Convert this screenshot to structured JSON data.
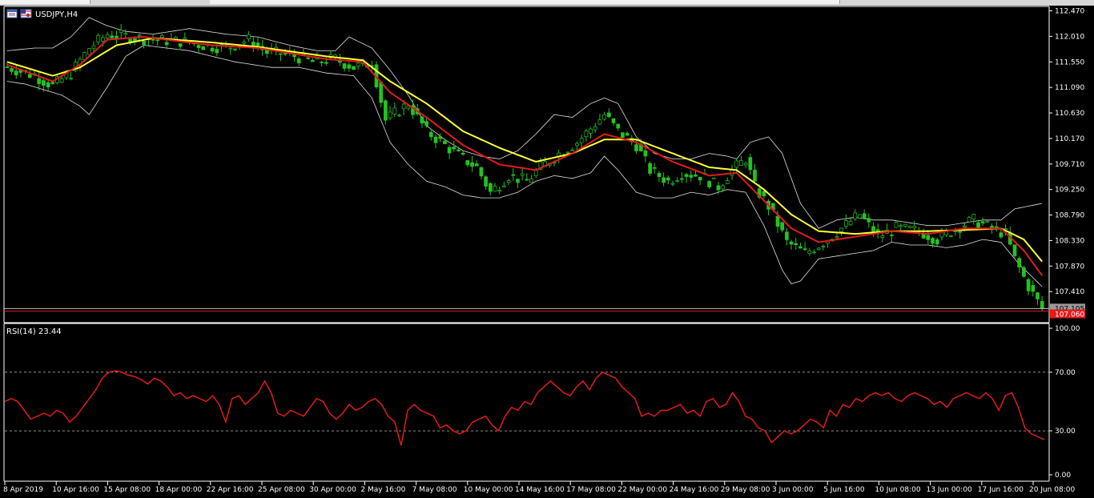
{
  "window": {
    "symbol_title": "USDJPY,H4",
    "icon": "chart-window-icon"
  },
  "colors": {
    "background": "#000000",
    "grid": "#1a1a1a",
    "axis": "#ffffff",
    "bull_candle": "#22c322",
    "bear_candle": "#c8f0c8",
    "ma_fast": "#e31b1b",
    "ma_slow": "#ffff33",
    "bollinger": "#e0e0e0",
    "rsi": "#e31b1b",
    "rsi_levels": "#c0c0c0",
    "bid_line": "#c0c0c0",
    "ask_line": "#e31b1b"
  },
  "chart_data": [
    {
      "type": "candlestick",
      "title": "USDJPY,H4",
      "ylim": [
        106.85,
        112.55
      ],
      "price_ticks": [
        "112.470",
        "112.010",
        "111.550",
        "111.090",
        "110.630",
        "110.170",
        "109.710",
        "109.250",
        "108.790",
        "108.330",
        "107.870",
        "107.410"
      ],
      "current_bid": "107.105",
      "current_ask": "107.060",
      "x_ticks": [
        "8 Apr 2019",
        "10 Apr 16:00",
        "15 Apr 08:00",
        "18 Apr 00:00",
        "22 Apr 16:00",
        "25 Apr 08:00",
        "30 Apr 00:00",
        "2 May 16:00",
        "7 May 08:00",
        "10 May 00:00",
        "14 May 16:00",
        "17 May 08:00",
        "22 May 00:00",
        "24 May 16:00",
        "29 May 08:00",
        "3 Jun 00:00",
        "5 Jun 16:00",
        "10 Jun 08:00",
        "13 Jun 00:00",
        "17 Jun 16:00",
        "20 Jun 08:00"
      ],
      "close_path": [
        [
          0,
          111.46
        ],
        [
          6,
          111.3
        ],
        [
          10,
          111.12
        ],
        [
          14,
          111.35
        ],
        [
          18,
          111.8
        ],
        [
          22,
          112.05
        ],
        [
          27,
          112.0
        ],
        [
          32,
          111.95
        ],
        [
          38,
          111.92
        ],
        [
          43,
          111.85
        ],
        [
          48,
          111.8
        ],
        [
          53,
          111.95
        ],
        [
          57,
          111.72
        ],
        [
          62,
          111.68
        ],
        [
          67,
          111.55
        ],
        [
          72,
          111.6
        ],
        [
          76,
          111.45
        ],
        [
          80,
          111.55
        ],
        [
          83,
          110.5
        ],
        [
          88,
          110.8
        ],
        [
          92,
          110.3
        ],
        [
          96,
          110.05
        ],
        [
          100,
          109.8
        ],
        [
          103,
          109.65
        ],
        [
          106,
          109.2
        ],
        [
          110,
          109.5
        ],
        [
          114,
          109.4
        ],
        [
          117,
          109.65
        ],
        [
          121,
          109.9
        ],
        [
          125,
          110.1
        ],
        [
          128,
          110.35
        ],
        [
          131,
          110.6
        ],
        [
          134,
          110.3
        ],
        [
          138,
          110.05
        ],
        [
          141,
          109.6
        ],
        [
          145,
          109.4
        ],
        [
          148,
          109.55
        ],
        [
          152,
          109.5
        ],
        [
          156,
          109.3
        ],
        [
          159,
          109.6
        ],
        [
          162,
          109.8
        ],
        [
          164,
          109.3
        ],
        [
          167,
          108.95
        ],
        [
          171,
          108.3
        ],
        [
          175,
          108.1
        ],
        [
          179,
          108.3
        ],
        [
          183,
          108.55
        ],
        [
          187,
          108.8
        ],
        [
          191,
          108.4
        ],
        [
          195,
          108.55
        ],
        [
          200,
          108.5
        ],
        [
          204,
          108.35
        ],
        [
          208,
          108.55
        ],
        [
          212,
          108.7
        ],
        [
          216,
          108.55
        ],
        [
          219,
          108.45
        ],
        [
          221,
          108.0
        ],
        [
          224,
          107.5
        ],
        [
          227,
          107.1
        ]
      ],
      "ma_fast_path": [
        [
          0,
          111.5
        ],
        [
          10,
          111.2
        ],
        [
          16,
          111.5
        ],
        [
          22,
          111.95
        ],
        [
          30,
          112.0
        ],
        [
          45,
          111.85
        ],
        [
          55,
          111.8
        ],
        [
          70,
          111.6
        ],
        [
          78,
          111.55
        ],
        [
          84,
          111.0
        ],
        [
          92,
          110.55
        ],
        [
          100,
          110.05
        ],
        [
          108,
          109.7
        ],
        [
          116,
          109.6
        ],
        [
          124,
          109.9
        ],
        [
          131,
          110.25
        ],
        [
          138,
          110.1
        ],
        [
          146,
          109.75
        ],
        [
          154,
          109.5
        ],
        [
          160,
          109.55
        ],
        [
          166,
          109.05
        ],
        [
          172,
          108.55
        ],
        [
          178,
          108.3
        ],
        [
          186,
          108.4
        ],
        [
          194,
          108.5
        ],
        [
          202,
          108.45
        ],
        [
          210,
          108.55
        ],
        [
          218,
          108.55
        ],
        [
          223,
          108.15
        ],
        [
          227,
          107.7
        ]
      ],
      "ma_slow_path": [
        [
          0,
          111.55
        ],
        [
          10,
          111.3
        ],
        [
          16,
          111.45
        ],
        [
          24,
          111.85
        ],
        [
          32,
          111.98
        ],
        [
          45,
          111.9
        ],
        [
          55,
          111.82
        ],
        [
          70,
          111.65
        ],
        [
          78,
          111.58
        ],
        [
          84,
          111.2
        ],
        [
          92,
          110.8
        ],
        [
          100,
          110.3
        ],
        [
          108,
          110.0
        ],
        [
          116,
          109.75
        ],
        [
          124,
          109.9
        ],
        [
          131,
          110.15
        ],
        [
          138,
          110.15
        ],
        [
          146,
          109.9
        ],
        [
          154,
          109.65
        ],
        [
          160,
          109.6
        ],
        [
          166,
          109.25
        ],
        [
          172,
          108.8
        ],
        [
          178,
          108.5
        ],
        [
          186,
          108.45
        ],
        [
          194,
          108.5
        ],
        [
          202,
          108.5
        ],
        [
          210,
          108.52
        ],
        [
          218,
          108.55
        ],
        [
          223,
          108.35
        ],
        [
          227,
          107.95
        ]
      ],
      "bb_upper_path": [
        [
          0,
          111.75
        ],
        [
          6,
          111.8
        ],
        [
          10,
          111.8
        ],
        [
          14,
          112.0
        ],
        [
          18,
          112.35
        ],
        [
          22,
          112.2
        ],
        [
          26,
          112.1
        ],
        [
          32,
          112.05
        ],
        [
          40,
          112.15
        ],
        [
          48,
          112.05
        ],
        [
          55,
          112.0
        ],
        [
          62,
          111.85
        ],
        [
          68,
          111.75
        ],
        [
          72,
          111.75
        ],
        [
          75,
          112.0
        ],
        [
          80,
          111.8
        ],
        [
          84,
          111.4
        ],
        [
          88,
          110.95
        ],
        [
          92,
          110.4
        ],
        [
          96,
          110.15
        ],
        [
          100,
          109.95
        ],
        [
          104,
          109.85
        ],
        [
          108,
          109.8
        ],
        [
          112,
          109.95
        ],
        [
          116,
          110.25
        ],
        [
          120,
          110.6
        ],
        [
          124,
          110.55
        ],
        [
          128,
          110.8
        ],
        [
          131,
          110.9
        ],
        [
          134,
          110.8
        ],
        [
          138,
          110.2
        ],
        [
          142,
          109.9
        ],
        [
          146,
          109.8
        ],
        [
          150,
          109.8
        ],
        [
          154,
          109.9
        ],
        [
          158,
          109.85
        ],
        [
          160,
          109.8
        ],
        [
          163,
          110.1
        ],
        [
          167,
          110.2
        ],
        [
          170,
          109.9
        ],
        [
          174,
          109.0
        ],
        [
          178,
          108.55
        ],
        [
          182,
          108.7
        ],
        [
          186,
          108.75
        ],
        [
          190,
          108.7
        ],
        [
          194,
          108.7
        ],
        [
          198,
          108.65
        ],
        [
          202,
          108.6
        ],
        [
          206,
          108.6
        ],
        [
          210,
          108.65
        ],
        [
          214,
          108.7
        ],
        [
          218,
          108.7
        ],
        [
          221,
          108.9
        ],
        [
          224,
          108.95
        ],
        [
          227,
          109.0
        ]
      ],
      "bb_lower_path": [
        [
          0,
          111.2
        ],
        [
          4,
          111.15
        ],
        [
          8,
          111.05
        ],
        [
          12,
          110.95
        ],
        [
          16,
          110.75
        ],
        [
          18,
          110.6
        ],
        [
          22,
          111.1
        ],
        [
          26,
          111.65
        ],
        [
          30,
          111.85
        ],
        [
          40,
          111.75
        ],
        [
          50,
          111.55
        ],
        [
          58,
          111.45
        ],
        [
          64,
          111.45
        ],
        [
          70,
          111.35
        ],
        [
          76,
          111.3
        ],
        [
          80,
          110.9
        ],
        [
          84,
          110.1
        ],
        [
          88,
          109.7
        ],
        [
          92,
          109.4
        ],
        [
          96,
          109.3
        ],
        [
          100,
          109.15
        ],
        [
          104,
          109.1
        ],
        [
          108,
          109.1
        ],
        [
          112,
          109.2
        ],
        [
          116,
          109.4
        ],
        [
          120,
          109.5
        ],
        [
          124,
          109.45
        ],
        [
          128,
          109.55
        ],
        [
          131,
          109.85
        ],
        [
          134,
          109.6
        ],
        [
          138,
          109.2
        ],
        [
          142,
          109.1
        ],
        [
          146,
          109.1
        ],
        [
          150,
          109.2
        ],
        [
          154,
          109.15
        ],
        [
          158,
          109.25
        ],
        [
          162,
          109.2
        ],
        [
          166,
          108.6
        ],
        [
          170,
          107.8
        ],
        [
          172,
          107.55
        ],
        [
          174,
          107.6
        ],
        [
          178,
          108.0
        ],
        [
          182,
          108.05
        ],
        [
          186,
          108.1
        ],
        [
          190,
          108.15
        ],
        [
          194,
          108.3
        ],
        [
          198,
          108.25
        ],
        [
          202,
          108.25
        ],
        [
          206,
          108.2
        ],
        [
          210,
          108.25
        ],
        [
          214,
          108.35
        ],
        [
          218,
          108.3
        ],
        [
          222,
          107.9
        ],
        [
          227,
          107.5
        ]
      ]
    },
    {
      "type": "line",
      "title": "RSI(14) 23.44",
      "ylim": [
        0,
        100
      ],
      "levels": [
        70,
        30
      ],
      "y_ticks": [
        "100.00",
        "70.00",
        "30.00",
        "0.00"
      ],
      "series": [
        {
          "values": [
            50,
            52,
            50,
            44,
            38,
            40,
            42,
            40,
            44,
            42,
            36,
            40,
            46,
            52,
            58,
            66,
            70,
            71,
            70,
            68,
            67,
            65,
            62,
            66,
            64,
            60,
            54,
            56,
            52,
            54,
            52,
            50,
            54,
            48,
            36,
            52,
            54,
            48,
            52,
            56,
            64,
            56,
            42,
            40,
            44,
            42,
            40,
            46,
            52,
            50,
            42,
            38,
            42,
            48,
            44,
            46,
            50,
            52,
            48,
            40,
            36,
            20,
            44,
            48,
            44,
            42,
            40,
            32,
            34,
            30,
            28,
            30,
            36,
            38,
            40,
            34,
            30,
            40,
            46,
            44,
            50,
            48,
            56,
            60,
            64,
            60,
            56,
            54,
            60,
            64,
            58,
            66,
            70,
            68,
            66,
            60,
            56,
            52,
            40,
            42,
            40,
            44,
            44,
            46,
            48,
            42,
            44,
            40,
            50,
            52,
            46,
            48,
            56,
            50,
            40,
            38,
            32,
            30,
            22,
            26,
            30,
            28,
            30,
            34,
            38,
            36,
            32,
            44,
            40,
            48,
            46,
            52,
            50,
            54,
            56,
            54,
            56,
            52,
            50,
            54,
            56,
            54,
            52,
            48,
            50,
            46,
            52,
            54,
            56,
            54,
            52,
            56,
            52,
            44,
            54,
            56,
            46,
            32,
            28,
            26,
            24
          ]
        }
      ]
    }
  ]
}
